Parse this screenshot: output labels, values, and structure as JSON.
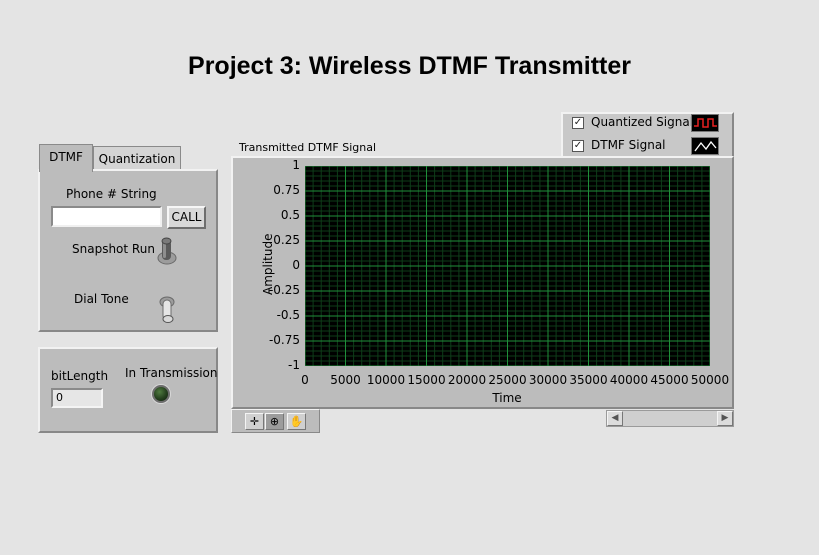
{
  "page": {
    "title": "Project 3: Wireless DTMF Transmitter"
  },
  "tabs": [
    {
      "label": "DTMF",
      "active": true
    },
    {
      "label": "Quantization",
      "active": false
    }
  ],
  "dtmf_panel": {
    "phone_label": "Phone # String",
    "phone_value": "",
    "call_button": "CALL",
    "snapshot_label": "Snapshot Run",
    "snapshot_on": false,
    "dial_tone_label": "Dial Tone",
    "dial_tone_on": false
  },
  "status_panel": {
    "bitlength_label": "bitLength",
    "bitlength_value": "0",
    "transmission_label": "In Transmission",
    "transmission_on": false
  },
  "legend": {
    "items": [
      {
        "label": "Quantized Signal",
        "checked": true,
        "icon": "square-wave-icon",
        "color": "#e82020"
      },
      {
        "label": "DTMF Signal",
        "checked": true,
        "icon": "line-wave-icon",
        "color": "#ffffff"
      }
    ]
  },
  "colors": {
    "plot_background": "#000000",
    "grid_major": "#1f8f3a",
    "grid_minor": "#0e3d19"
  },
  "chart_data": {
    "type": "line",
    "title": "Transmitted DTMF Signal",
    "xlabel": "Time",
    "ylabel": "Amplitude",
    "xlim": [
      0,
      50000
    ],
    "ylim": [
      -1,
      1
    ],
    "x_ticks": [
      "0",
      "5000",
      "10000",
      "15000",
      "20000",
      "25000",
      "30000",
      "35000",
      "40000",
      "45000",
      "50000"
    ],
    "y_ticks": [
      "1",
      "0.75",
      "0.5",
      "0.25",
      "0",
      "-0.25",
      "-0.5",
      "-0.75",
      "-1"
    ],
    "grid": true,
    "series": [
      {
        "name": "Quantized Signal",
        "values": []
      },
      {
        "name": "DTMF Signal",
        "values": []
      }
    ]
  },
  "graph_palette": {
    "tools": [
      "crosshair-icon",
      "zoom-icon",
      "pan-hand-icon"
    ]
  }
}
